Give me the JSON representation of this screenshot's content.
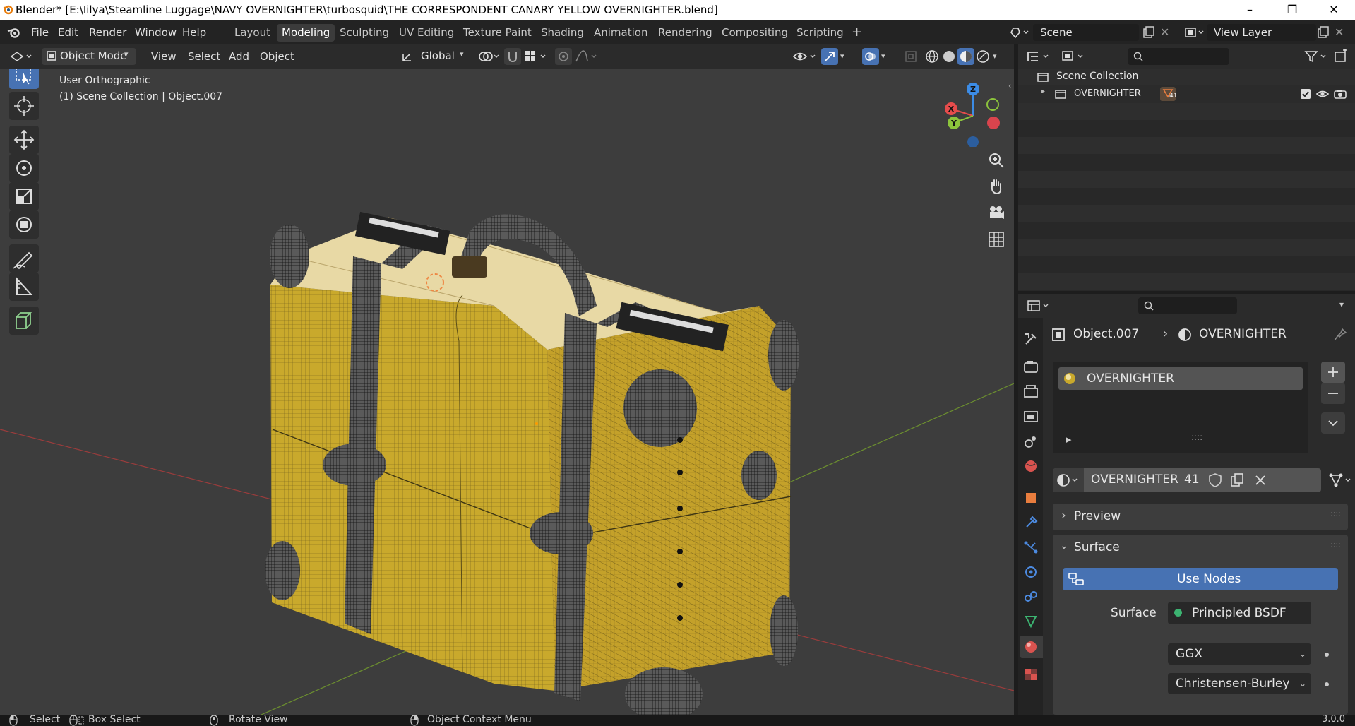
{
  "window": {
    "title": "Blender* [E:\\Iilya\\Steamline Luggage\\NAVY OVERNIGHTER\\turbosquid\\THE CORRESPONDENT CANARY YELLOW OVERNIGHTER.blend]",
    "controls": [
      "–",
      "❐",
      "✕"
    ]
  },
  "menu": {
    "items": [
      "File",
      "Edit",
      "Render",
      "Window",
      "Help"
    ]
  },
  "workspaces": {
    "tabs": [
      "Layout",
      "Modeling",
      "Sculpting",
      "UV Editing",
      "Texture Paint",
      "Shading",
      "Animation",
      "Rendering",
      "Compositing",
      "Scripting"
    ],
    "active": "Modeling",
    "add": "+"
  },
  "scene": {
    "name": "Scene",
    "view_layer": "View Layer"
  },
  "viewport_header": {
    "mode": "Object Mode",
    "menus": [
      "View",
      "Select",
      "Add",
      "Object"
    ],
    "orientation": "Global"
  },
  "viewport": {
    "view_name": "User Orthographic",
    "context": "(1) Scene Collection | Object.007",
    "gizmo_axes": [
      "X",
      "Y",
      "Z"
    ],
    "suitcase_color": "#c9a92c"
  },
  "outliner": {
    "root": "Scene Collection",
    "items": [
      {
        "name": "OVERNIGHTER",
        "badge": "41"
      }
    ]
  },
  "properties": {
    "breadcrumb_object": "Object.007",
    "breadcrumb_material": "OVERNIGHTER",
    "material_slot": "OVERNIGHTER",
    "material_name": "OVERNIGHTER",
    "user_count": "41",
    "panels": {
      "preview": "Preview",
      "surface": "Surface"
    },
    "use_nodes": "Use Nodes",
    "surface_label": "Surface",
    "surface_value": "Principled BSDF",
    "distribution": "GGX",
    "subsurface_method": "Christensen-Burley"
  },
  "statusbar": {
    "select": "Select",
    "box_select": "Box Select",
    "rotate_view": "Rotate View",
    "context_menu": "Object Context Menu",
    "version": "3.0.0"
  },
  "colors": {
    "accent": "#4772b3",
    "active_tool": "#4772b3",
    "x_axis": "#e64c4c",
    "y_axis": "#8cc43c",
    "z_axis": "#3c8ce6",
    "material_orange": "#e87d3e"
  }
}
